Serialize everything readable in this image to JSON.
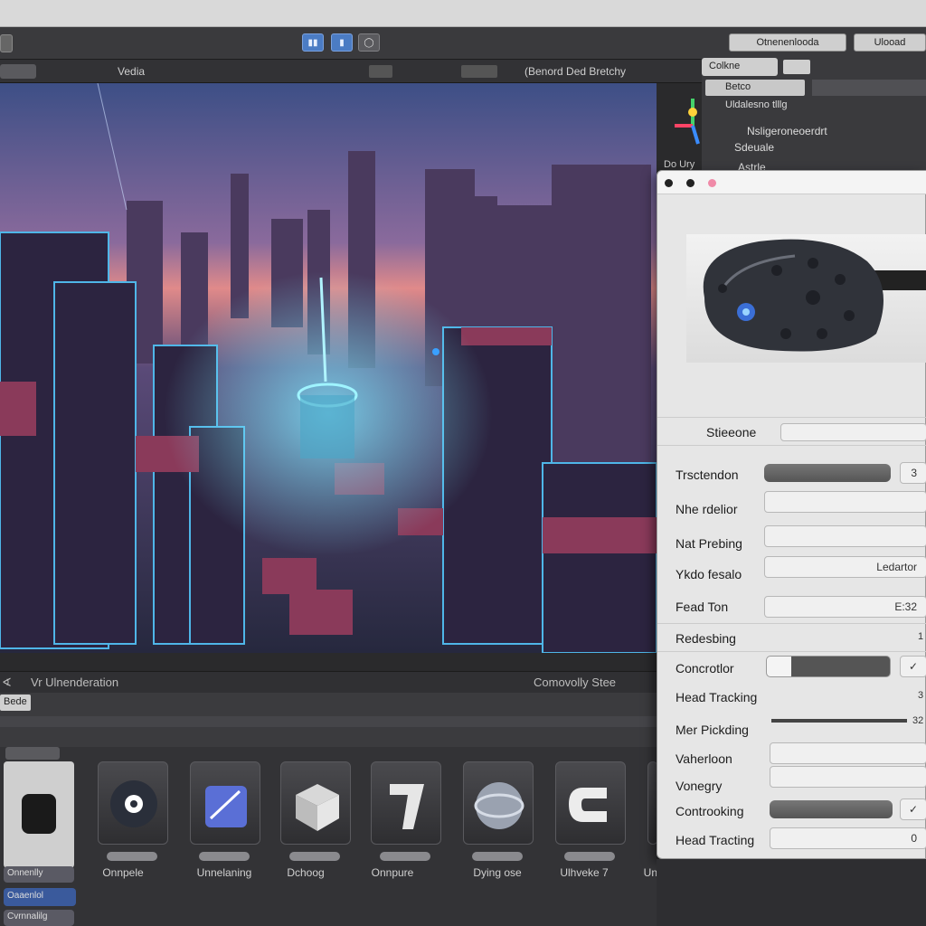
{
  "toolbar": {
    "right_buttons": [
      "Otnenenlooda",
      "Ulooad"
    ]
  },
  "viewport": {
    "tab_label": "Vedia",
    "header_text": "(Benord Ded Bretchy",
    "scene_label_left": "Vr Ulnenderation",
    "scene_label_right": "Comovolly Stee",
    "strip_tab": "Bede"
  },
  "hierarchy": {
    "search_label": "Colkne",
    "filter_label": "Betco",
    "items": [
      "Uldalesno tlllg",
      "Nsligeroneoerdrt",
      "Sdeuale",
      "Astrle"
    ],
    "side_label": "Do Ury"
  },
  "inspector": {
    "preview_alt": "VR headset",
    "rows": [
      {
        "label": "Stieeone",
        "value": ""
      },
      {
        "label": "Trsctendon",
        "value": "3"
      },
      {
        "label": "Nhe rdelior",
        "value": ""
      },
      {
        "label": "Nat Prebing",
        "value": ""
      },
      {
        "label": "Ykdo fesalo",
        "value": "Ledartor"
      },
      {
        "label": "Fead Ton",
        "value": "E:32"
      },
      {
        "label": "Redesbing",
        "value": "1"
      },
      {
        "label": "Concrotlor",
        "value": ""
      },
      {
        "label": "Head Tracking",
        "value": "3"
      },
      {
        "label": "Mer Pickding",
        "value": "32"
      },
      {
        "label": "Vaherloon",
        "value": ""
      },
      {
        "label": "Vonegry",
        "value": ""
      },
      {
        "label": "Controoking",
        "value": ""
      },
      {
        "label": "Head Tracting",
        "value": "0"
      }
    ]
  },
  "tray": {
    "left_tabs": [
      "Onnenlly",
      "Oaaenlol",
      "Cvrnnalilg"
    ],
    "tiles": [
      {
        "label": "Onnpele",
        "icon": "gear-icon"
      },
      {
        "label": "Unnelaning",
        "icon": "ruler-icon"
      },
      {
        "label": "Dchoog",
        "icon": "box-icon"
      },
      {
        "label": "Onnpure",
        "icon": "shield-icon"
      },
      {
        "label": "Dying ose",
        "icon": "sphere-icon"
      },
      {
        "label": "Ulhveke 7",
        "icon": "c-icon"
      },
      {
        "label": "Unlialg",
        "icon": "blank-icon"
      }
    ]
  }
}
